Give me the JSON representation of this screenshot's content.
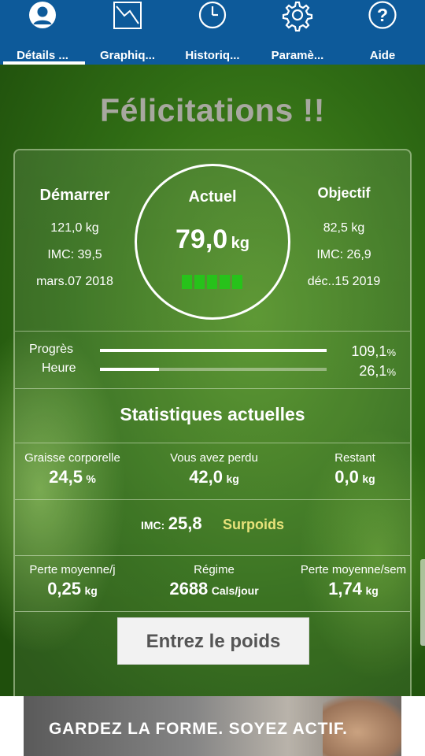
{
  "nav": {
    "tabs": [
      {
        "label": "Détails ...",
        "icon": "user-icon",
        "active": true
      },
      {
        "label": "Graphiq...",
        "icon": "chart-icon",
        "active": false
      },
      {
        "label": "Historiq...",
        "icon": "clock-icon",
        "active": false
      },
      {
        "label": "Paramè...",
        "icon": "gear-icon",
        "active": false
      },
      {
        "label": "Aide",
        "icon": "help-icon",
        "active": false
      }
    ]
  },
  "title": "Félicitations !!",
  "start": {
    "label": "Démarrer",
    "weight": "121,0 kg",
    "bmi": "IMC: 39,5",
    "date": "mars.07 2018"
  },
  "current": {
    "label": "Actuel",
    "value": "79,0",
    "unit": "kg",
    "level_blocks": 5
  },
  "goal": {
    "label": "Objectif",
    "weight": "82,5 kg",
    "bmi": "IMC: 26,9",
    "date": "déc..15 2019"
  },
  "progress": {
    "progress_label": "Progrès",
    "progress_value": "109,1",
    "progress_unit": "%",
    "progress_fraction": 1.0,
    "time_label": "Heure",
    "time_value": "26,1",
    "time_unit": "%",
    "time_fraction": 0.261
  },
  "stats": {
    "heading": "Statistiques actuelles",
    "body_fat_label": "Graisse corporelle",
    "body_fat_value": "24,5",
    "body_fat_unit": "%",
    "lost_label": "Vous avez perdu",
    "lost_value": "42,0",
    "lost_unit": "kg",
    "remaining_label": "Restant",
    "remaining_value": "0,0",
    "remaining_unit": "kg",
    "bmi_label": "IMC:",
    "bmi_value": "25,8",
    "bmi_category": "Surpoids",
    "avg_day_label": "Perte moyenne/j",
    "avg_day_value": "0,25",
    "avg_day_unit": "kg",
    "diet_label": "Régime",
    "diet_value": "2688",
    "diet_unit": "Cals/jour",
    "avg_week_label": "Perte moyenne/sem",
    "avg_week_value": "1,74",
    "avg_week_unit": "kg"
  },
  "enter_weight_button": "Entrez le poids",
  "ad": {
    "text": "GARDEZ LA FORME. SOYEZ ACTIF."
  },
  "colors": {
    "nav": "#0d5a9a",
    "accent_yellow": "#f5ee25",
    "bmi_category": "#e8e27a",
    "level_green": "#27c21a"
  }
}
